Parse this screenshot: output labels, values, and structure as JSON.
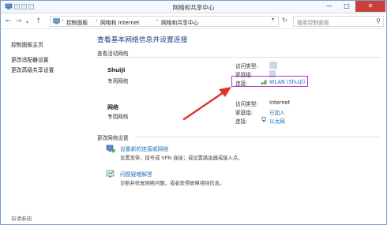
{
  "window": {
    "title": "网络和共享中心",
    "controls": [
      "—",
      "□",
      "✕"
    ]
  },
  "address": {
    "crumbs": [
      "控制面板",
      "网络和 Internet",
      "网络和共享中心"
    ],
    "search_placeholder": "搜索控制面板"
  },
  "sidebar": {
    "items": [
      {
        "label": "控制面板主页"
      },
      {
        "label": "更改适配器设置"
      },
      {
        "label": "更改高级共享设置"
      }
    ],
    "see_also": "另请参阅"
  },
  "main": {
    "heading": "查看基本网络信息并设置连接",
    "active_section": "查看活动网络",
    "networks": [
      {
        "name": "ShuiJi",
        "type": "专用网络",
        "access_label": "访问类型:",
        "access_value": "",
        "homegroup_label": "家庭组:",
        "homegroup_value": "",
        "conn_label": "连接:",
        "conn_value": "WLAN (ShuiJi)"
      },
      {
        "name": "网络",
        "type": "专用网络",
        "access_label": "访问类型:",
        "access_value": "Internet",
        "homegroup_label": "家庭组:",
        "homegroup_value": "已加入",
        "conn_label": "连接:",
        "conn_value": "以太网"
      }
    ],
    "change_section": "更改网络设置",
    "tasks": [
      {
        "title": "设置新的连接或网络",
        "desc": "设置宽带、拨号或 VPN 连接；或设置路由器或接入点。"
      },
      {
        "title": "问题疑难解答",
        "desc": "诊断并修复网络问题，或者获得故障排除信息。"
      }
    ]
  },
  "colors": {
    "heading": "#1c3c84",
    "link": "#1d6fb8",
    "highlight": "#c22bcf",
    "arrow": "#e0332a"
  }
}
